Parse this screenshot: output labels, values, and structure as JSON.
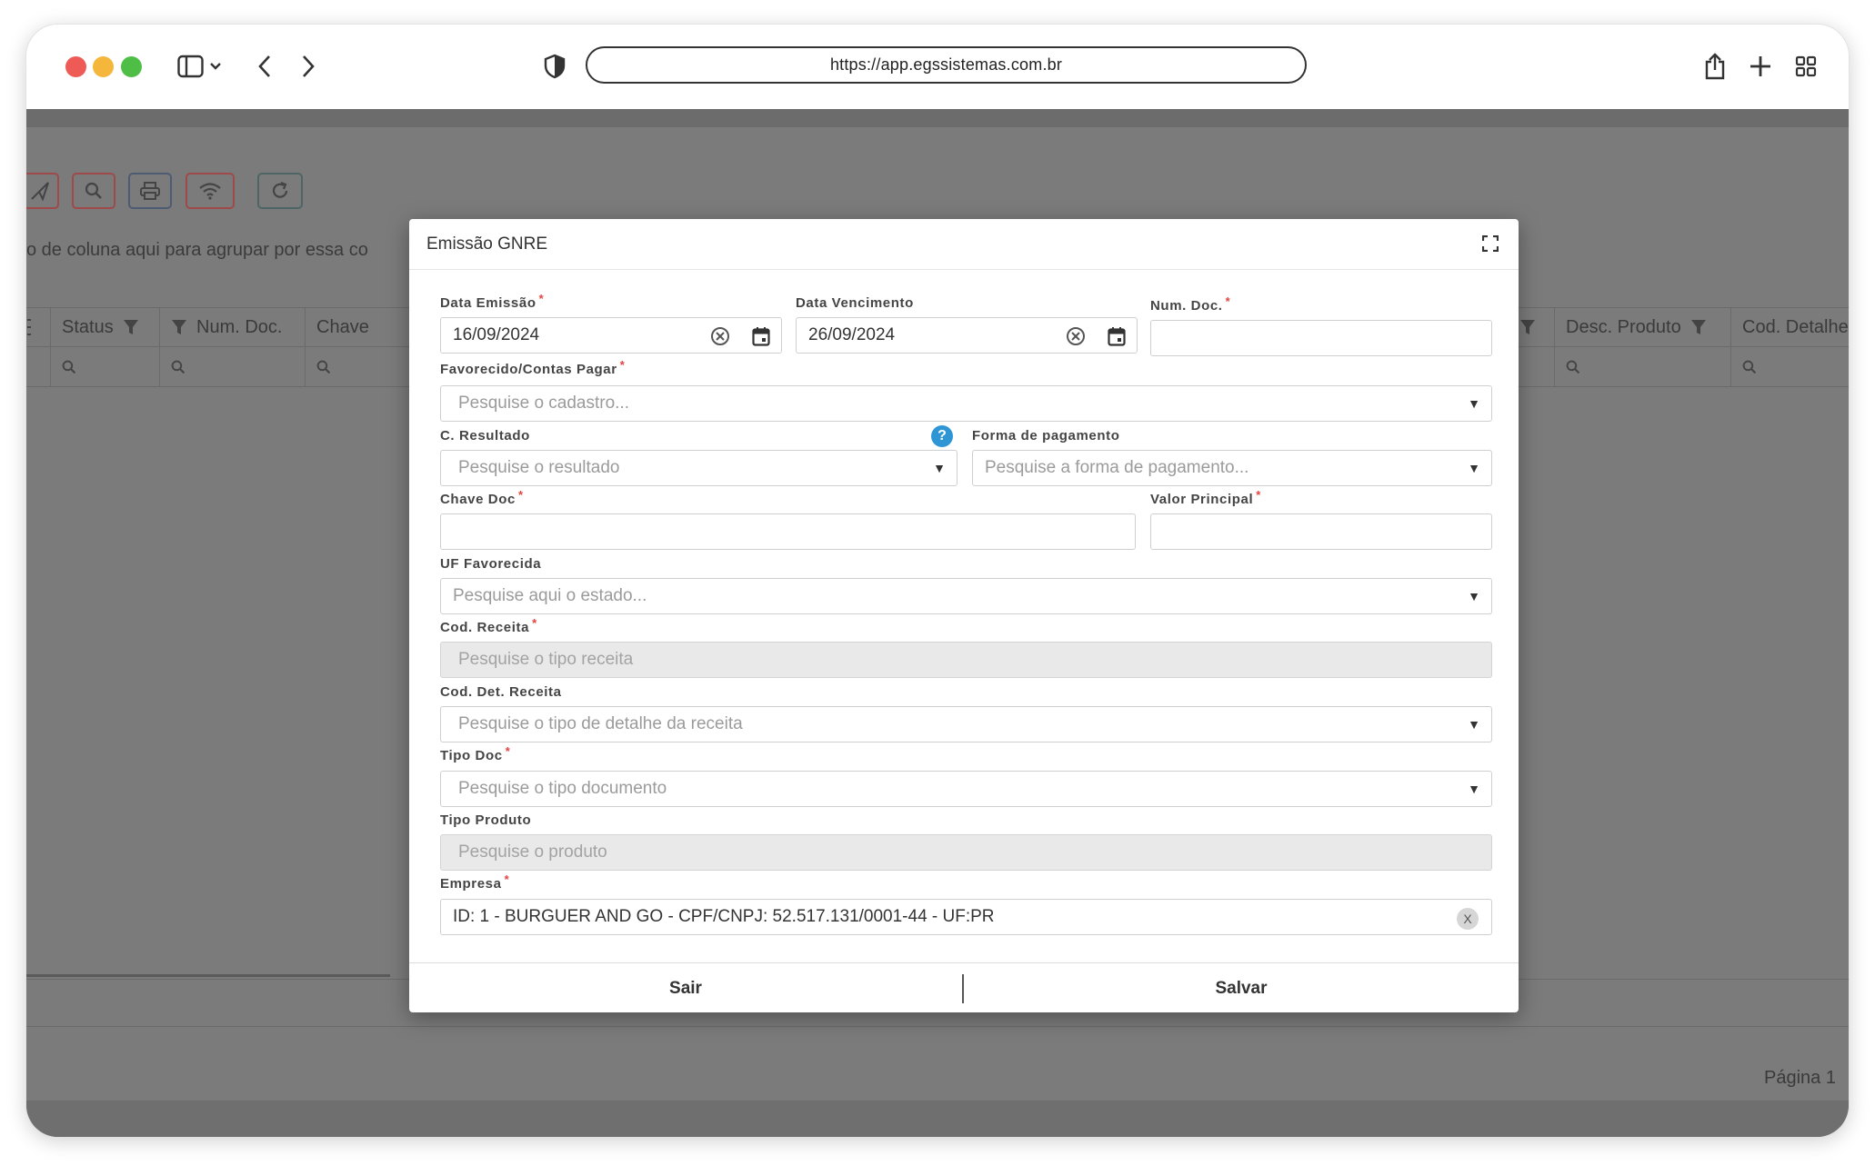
{
  "browser": {
    "url": "https://app.egssistemas.com.br"
  },
  "background": {
    "group_hint": "o de coluna aqui para agrupar por essa co",
    "columns_left": [
      {
        "label": "Status"
      },
      {
        "label": "Num. Doc."
      },
      {
        "label": "Chave"
      }
    ],
    "columns_right": [
      {
        "label": "Desc. Produto"
      },
      {
        "label": "Cod. Detalhe"
      }
    ],
    "pager_label": "Página 1"
  },
  "modal": {
    "title": "Emissão GNRE",
    "fields": {
      "data_emissao": {
        "label": "Data Emissão",
        "value": "16/09/2024"
      },
      "data_vencimento": {
        "label": "Data Vencimento",
        "value": "26/09/2024"
      },
      "num_doc": {
        "label": "Num. Doc.",
        "value": ""
      },
      "favorecido": {
        "label": "Favorecido/Contas Pagar",
        "placeholder": "Pesquise o cadastro..."
      },
      "c_resultado": {
        "label": "C. Resultado",
        "placeholder": "Pesquise o resultado"
      },
      "forma_pagamento": {
        "label": "Forma de pagamento",
        "placeholder": "Pesquise a forma de pagamento..."
      },
      "chave_doc": {
        "label": "Chave Doc",
        "value": ""
      },
      "valor_principal": {
        "label": "Valor Principal",
        "value": ""
      },
      "uf_favorecida": {
        "label": "UF Favorecida",
        "placeholder": "Pesquise aqui o estado..."
      },
      "cod_receita": {
        "label": "Cod. Receita",
        "placeholder": "Pesquise o tipo receita"
      },
      "cod_det_receita": {
        "label": "Cod. Det. Receita",
        "placeholder": "Pesquise o tipo de detalhe da receita"
      },
      "tipo_doc": {
        "label": "Tipo Doc",
        "placeholder": "Pesquise o tipo documento"
      },
      "tipo_produto": {
        "label": "Tipo Produto",
        "placeholder": "Pesquise o produto"
      },
      "empresa": {
        "label": "Empresa",
        "value": "ID: 1 - BURGUER AND GO - CPF/CNPJ: 52.517.131/0001-44 - UF:PR",
        "clear_label": "X"
      }
    },
    "required_mark": "*",
    "help_mark": "?",
    "caret": "▼",
    "buttons": {
      "exit": "Sair",
      "save": "Salvar"
    }
  },
  "colors": {
    "required": "#e24343",
    "help": "#2f96d6",
    "overlay": "#7b7b7b"
  }
}
